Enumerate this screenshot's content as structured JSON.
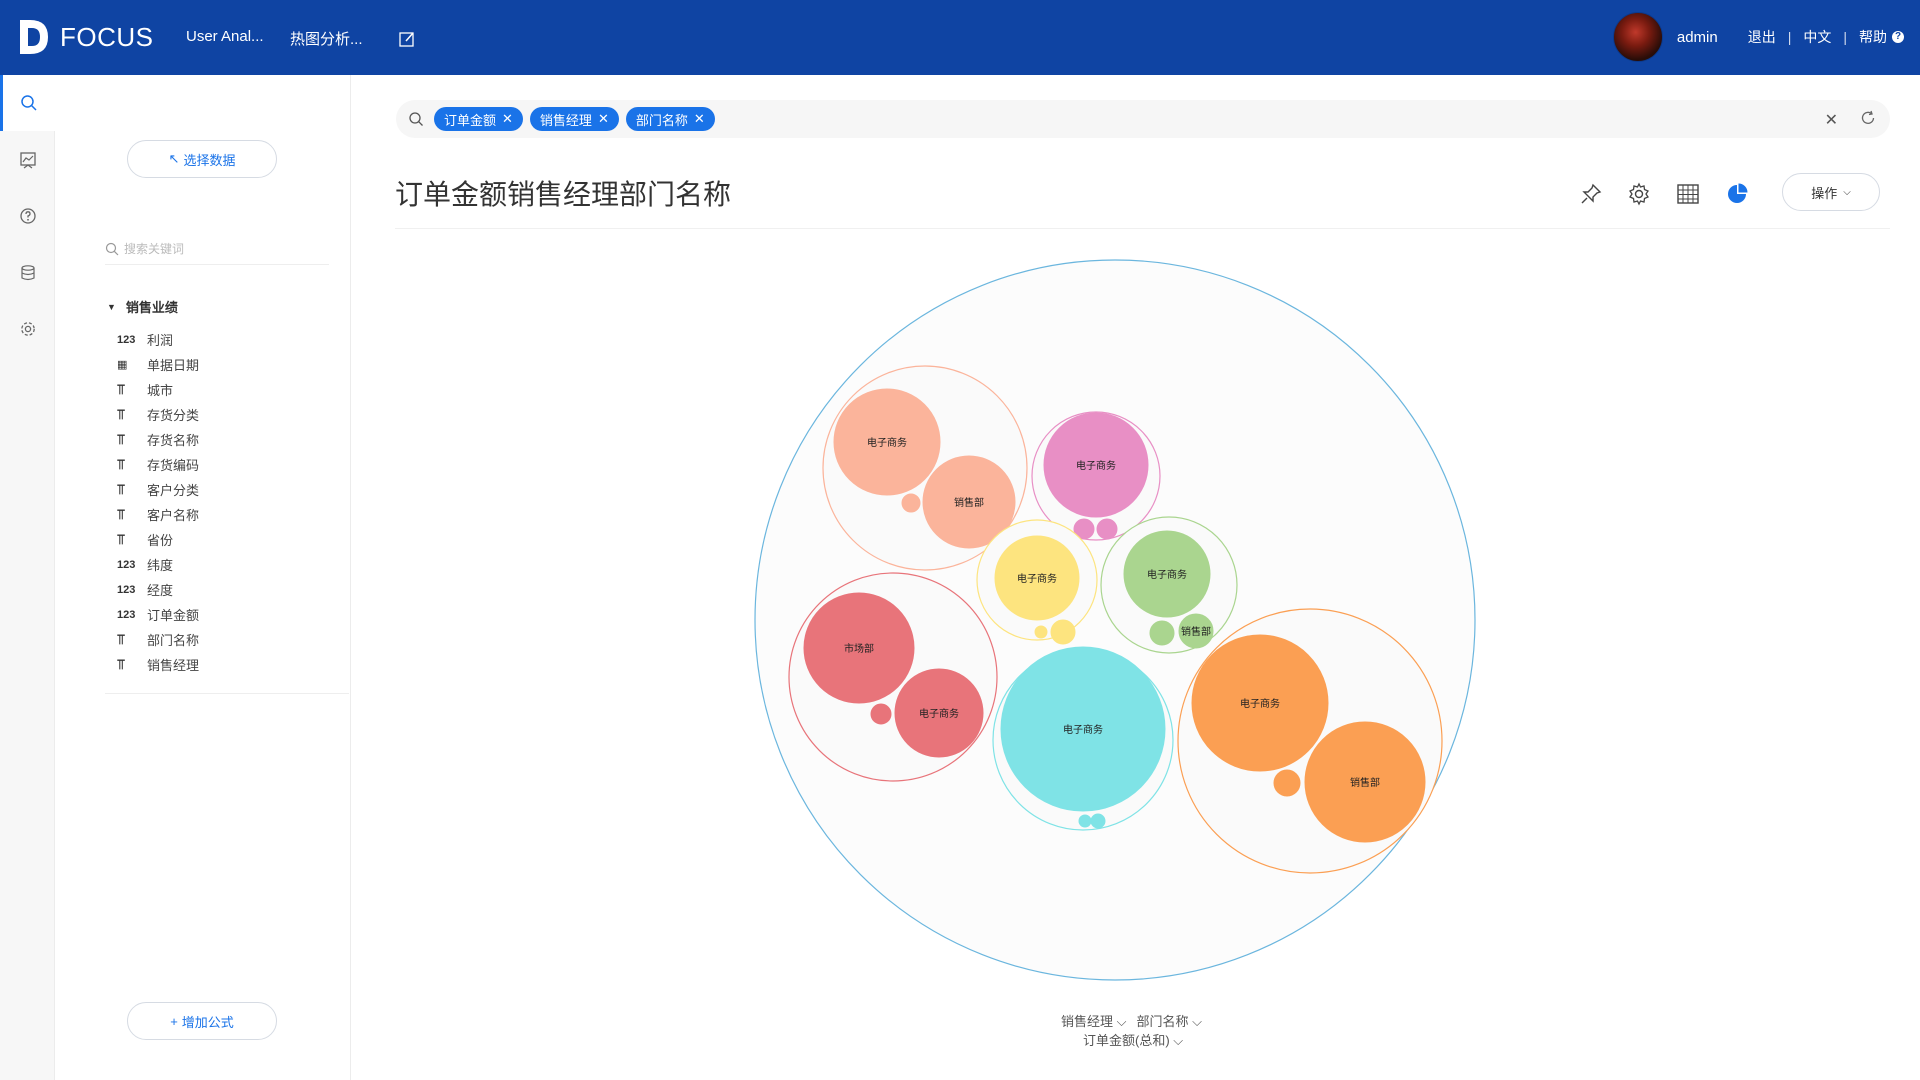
{
  "app": {
    "logo_text": "FOCUS",
    "tabs": [
      "User Anal...",
      "热图分析..."
    ],
    "user": "admin",
    "logout": "退出",
    "language": "中文",
    "help": "帮助",
    "help_glyph": "?"
  },
  "sidebar": {
    "select_data_label": "选择数据",
    "search_placeholder": "搜索关键词",
    "group_title": "销售业绩",
    "fields": [
      {
        "type": "123",
        "name": "利润"
      },
      {
        "type": "date",
        "name": "单据日期"
      },
      {
        "type": "text",
        "name": "城市"
      },
      {
        "type": "text",
        "name": "存货分类"
      },
      {
        "type": "text",
        "name": "存货名称"
      },
      {
        "type": "text",
        "name": "存货编码"
      },
      {
        "type": "text",
        "name": "客户分类"
      },
      {
        "type": "text",
        "name": "客户名称"
      },
      {
        "type": "text",
        "name": "省份"
      },
      {
        "type": "123",
        "name": "纬度"
      },
      {
        "type": "123",
        "name": "经度"
      },
      {
        "type": "123",
        "name": "订单金额"
      },
      {
        "type": "text",
        "name": "部门名称"
      },
      {
        "type": "text",
        "name": "销售经理"
      }
    ],
    "add_formula_label": "增加公式"
  },
  "search": {
    "tags": [
      "订单金额",
      "销售经理",
      "部门名称"
    ]
  },
  "main": {
    "title": "订单金额销售经理部门名称",
    "operations_label": "操作"
  },
  "colors": {
    "header_bg": "#0f44a3",
    "accent": "#1a73e8",
    "outer_circle": "#6bb6de"
  },
  "chart_data": {
    "type": "packed_bubble",
    "title": "",
    "hierarchy": [
      "销售经理",
      "部门名称"
    ],
    "size_field": "订单金额(总和)",
    "groups": [
      {
        "color": "#fbb49b",
        "children": [
          {
            "label": "电子商务",
            "r": 53
          },
          {
            "label": "销售部",
            "r": 46
          },
          {
            "label": "",
            "r": 9
          }
        ]
      },
      {
        "color": "#e88fc5",
        "children": [
          {
            "label": "电子商务",
            "r": 52
          },
          {
            "label": "",
            "r": 10
          },
          {
            "label": "",
            "r": 10
          }
        ]
      },
      {
        "color": "#fde47f",
        "children": [
          {
            "label": "电子商务",
            "r": 42
          },
          {
            "label": "",
            "r": 12
          },
          {
            "label": "",
            "r": 6
          }
        ]
      },
      {
        "color": "#aad58f",
        "children": [
          {
            "label": "电子商务",
            "r": 43
          },
          {
            "label": "销售部",
            "r": 17
          },
          {
            "label": "",
            "r": 12
          }
        ]
      },
      {
        "color": "#e8747a",
        "children": [
          {
            "label": "市场部",
            "r": 55
          },
          {
            "label": "电子商务",
            "r": 44
          },
          {
            "label": "",
            "r": 10
          }
        ]
      },
      {
        "color": "#7fe3e6",
        "children": [
          {
            "label": "电子商务",
            "r": 82
          },
          {
            "label": "",
            "r": 7
          },
          {
            "label": "",
            "r": 6
          }
        ]
      },
      {
        "color": "#fb9f53",
        "children": [
          {
            "label": "电子商务",
            "r": 68
          },
          {
            "label": "销售部",
            "r": 60
          },
          {
            "label": "",
            "r": 13
          }
        ]
      }
    ],
    "legend": {
      "row1": [
        "销售经理",
        "部门名称"
      ],
      "row2": [
        "订单金额(总和)"
      ]
    }
  }
}
